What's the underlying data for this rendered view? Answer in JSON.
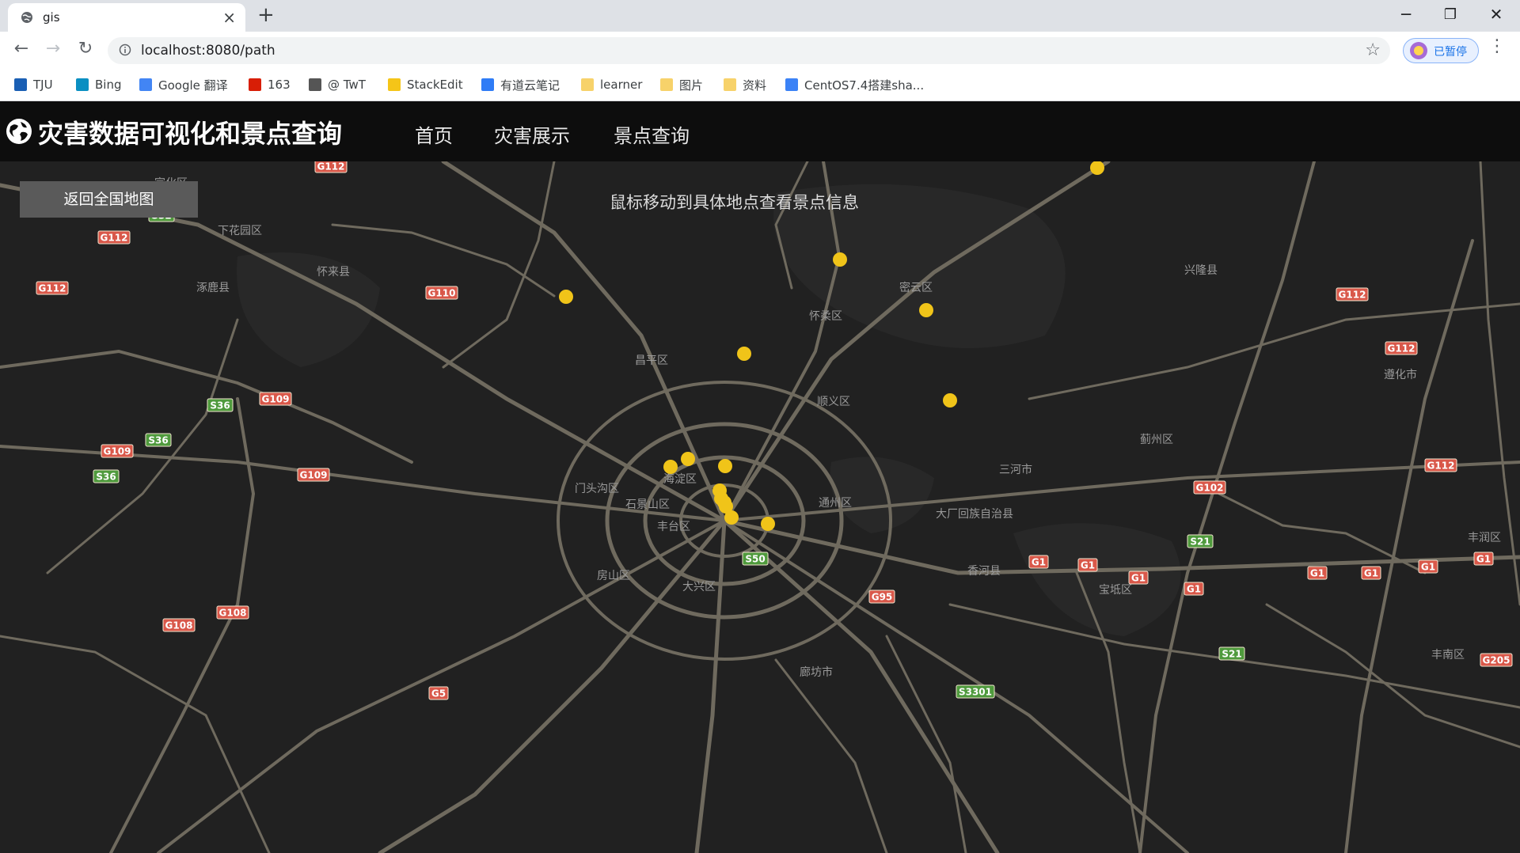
{
  "browser": {
    "tab_title": "gis",
    "url": "localhost:8080/path",
    "profile_label": "已暂停",
    "bookmarks": [
      {
        "label": "TJU",
        "color": "#1a5fb4"
      },
      {
        "label": "Bing",
        "color": "#0a8fc2"
      },
      {
        "label": "Google 翻译",
        "color": "#4285f4"
      },
      {
        "label": "163",
        "color": "#d81e06"
      },
      {
        "label": "@ TwT",
        "color": "#555555"
      },
      {
        "label": "StackEdit",
        "color": "#f5c518"
      },
      {
        "label": "有道云笔记",
        "color": "#2f7cf6"
      },
      {
        "label": "learner",
        "color": "#f7d26a"
      },
      {
        "label": "图片",
        "color": "#f7d26a"
      },
      {
        "label": "资料",
        "color": "#f7d26a"
      },
      {
        "label": "CentOS7.4搭建sha...",
        "color": "#3b82f6"
      }
    ]
  },
  "app": {
    "title": "灾害数据可视化和景点查询",
    "nav": [
      "首页",
      "灾害展示",
      "景点查询"
    ]
  },
  "map": {
    "back_button": "返回全国地图",
    "hint": "鼠标移动到具体地点查看景点信息",
    "marker_color": "#f0c419",
    "place_labels": [
      "宣化区",
      "下花园区",
      "怀来县",
      "涿鹿县",
      "昌平区",
      "怀柔区",
      "密云区",
      "兴隆县",
      "遵化市",
      "顺义区",
      "蓟州区",
      "三河市",
      "海淀区",
      "门头沟区",
      "石景山区",
      "丰台区",
      "通州区",
      "大厂回族自治县",
      "房山区",
      "大兴区",
      "香河县",
      "宝坻区",
      "廊坊市",
      "丰润区",
      "丰南区"
    ],
    "road_shields": [
      "G112",
      "S10",
      "S32",
      "G112",
      "G112",
      "G110",
      "S36",
      "G109",
      "S36",
      "G109",
      "S36",
      "G109",
      "G108",
      "G108",
      "G112",
      "G112",
      "G112",
      "G102",
      "S21",
      "G1",
      "G1",
      "G1",
      "G1",
      "G1",
      "G1",
      "G1",
      "G1",
      "S50",
      "G95",
      "S21",
      "G205",
      "S3301",
      "G5"
    ]
  }
}
